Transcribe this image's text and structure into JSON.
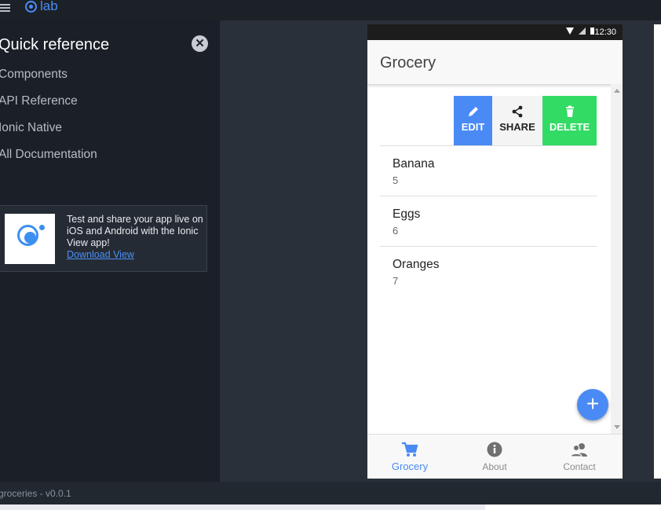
{
  "app": {
    "brand": "lab"
  },
  "sidebar": {
    "title": "Quick reference",
    "close_glyph": "✕",
    "links": [
      "Components",
      "API Reference",
      "Ionic Native",
      "All Documentation"
    ],
    "promo": {
      "text": "Test and share your app live on iOS and Android with the Ionic View app!",
      "link": "Download View"
    },
    "version": "groceries - v0.0.1"
  },
  "phone": {
    "status_time": "12:30",
    "title": "Grocery",
    "swipe_options": [
      {
        "label": "EDIT",
        "icon": "pencil-icon",
        "color": "#4a8af4"
      },
      {
        "label": "SHARE",
        "icon": "share-icon",
        "color": "#f4f4f4"
      },
      {
        "label": "DELETE",
        "icon": "trash-icon",
        "color": "#32db64"
      }
    ],
    "items": [
      {
        "name": "Banana",
        "quantity": "5"
      },
      {
        "name": "Eggs",
        "quantity": "6"
      },
      {
        "name": "Oranges",
        "quantity": "7"
      }
    ],
    "fab_glyph": "+",
    "tabs": [
      {
        "label": "Grocery",
        "icon": "cart-icon",
        "active": true
      },
      {
        "label": "About",
        "icon": "info-icon",
        "active": false
      },
      {
        "label": "Contact",
        "icon": "contacts-icon",
        "active": false
      }
    ]
  },
  "colors": {
    "accent": "#4a8af4",
    "danger_green": "#32db64",
    "sidebar_bg": "#1b2028"
  }
}
